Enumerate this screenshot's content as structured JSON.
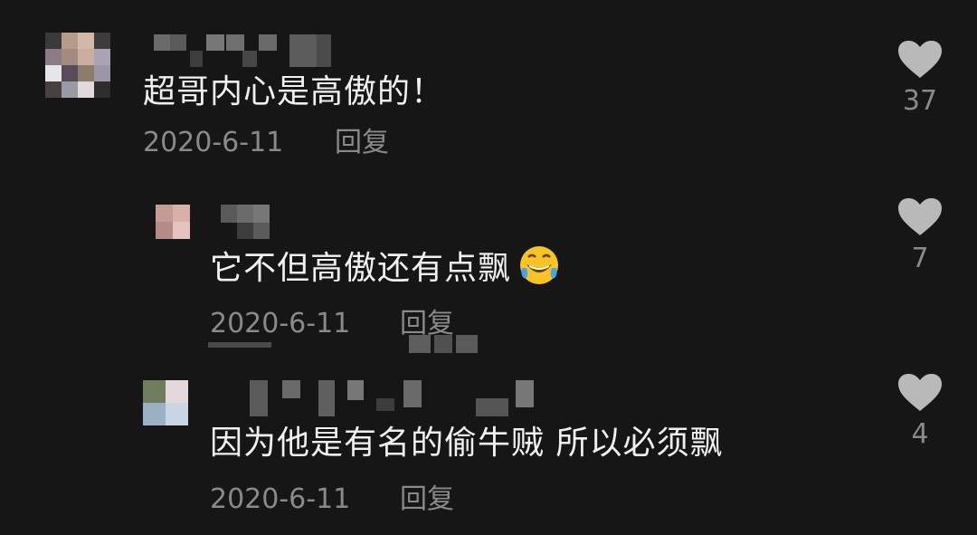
{
  "comments": [
    {
      "text": "超哥内心是高傲的！",
      "date": "2020-6-11",
      "reply_label": "回复",
      "likes": "37"
    },
    {
      "text": "它不但高傲还有点飘",
      "date": "2020-6-11",
      "reply_label": "回复",
      "likes": "7",
      "emoji": "rolling-on-floor-laughing-emoji"
    },
    {
      "text": "因为他是有名的偷牛贼 所以必须飘",
      "date": "2020-6-11",
      "reply_label": "回复",
      "likes": "4"
    }
  ],
  "icons": {
    "like": "heart-icon",
    "avatar": "blurred-avatar"
  },
  "colors": {
    "background": "#161616",
    "text": "#f0f0f0",
    "meta": "#8a8a8a",
    "heart": "#b9b9b9"
  }
}
